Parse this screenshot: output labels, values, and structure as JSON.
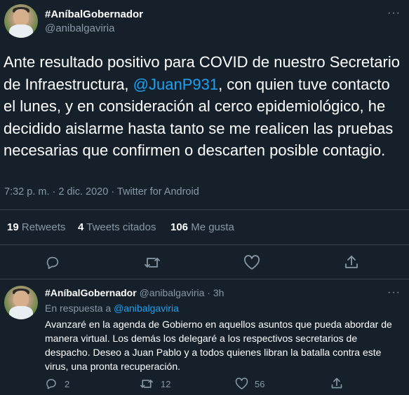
{
  "main_tweet": {
    "display_name": "#AníbalGobernador",
    "handle": "@anibalgaviria",
    "more_label": "···",
    "text_part1": "Ante resultado positivo para COVID de nuestro Secretario de Infraestructura, ",
    "mention": "@JuanP931",
    "text_part2": ", con quien tuve contacto el lunes, y en consideración al cerco epidemiológico, he decidido aislarme hasta tanto se me realicen las pruebas necesarias que confirmen o descarten posible contagio.",
    "timestamp": "7:32 p. m. · 2 dic. 2020 · Twitter for Android",
    "retweets_count": "19",
    "retweets_label": "Retweets",
    "quotes_count": "4",
    "quotes_label": "Tweets citados",
    "likes_count": "106",
    "likes_label": "Me gusta"
  },
  "reply_tweet": {
    "display_name": "#AníbalGobernador",
    "handle_time": "@anibalgaviria · 3h",
    "more_label": "···",
    "reply_prefix": "En respuesta a ",
    "reply_to": "@anibalgaviria",
    "text": "Avanzaré en la agenda de Gobierno en aquellos asuntos que pueda abordar de manera virtual. Los demás los delegaré a los respectivos secretarios de despacho. Deseo a Juan Pablo y a todos quienes libran la batalla contra este virus, una pronta recuperación.",
    "reply_count": "2",
    "retweet_count": "12",
    "like_count": "56"
  },
  "icons": [
    "comment-icon",
    "retweet-icon",
    "heart-icon",
    "share-icon",
    "more-icon"
  ],
  "colors": {
    "background": "#15202b",
    "text": "#ffffff",
    "muted": "#8899a6",
    "link": "#1da1f2",
    "divider": "#38444d"
  }
}
